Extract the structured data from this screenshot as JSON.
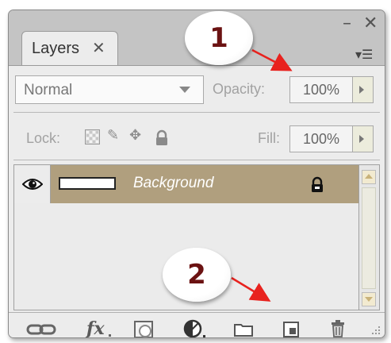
{
  "panel": {
    "minimize_icon": "minimize-icon",
    "close_icon": "close-icon",
    "tab_label": "Layers",
    "tab_close_icon": "close-icon",
    "menu_icon": "panel-menu-icon"
  },
  "blend": {
    "mode": "Normal"
  },
  "opacity": {
    "label": "Opacity:",
    "value": "100%"
  },
  "lock": {
    "label": "Lock:",
    "icons": [
      "lock-transparent-icon",
      "lock-image-icon",
      "lock-position-icon",
      "lock-all-icon"
    ]
  },
  "fill": {
    "label": "Fill:",
    "value": "100%"
  },
  "layers": [
    {
      "name": "Background",
      "visible": true,
      "locked": true
    }
  ],
  "footer": {
    "buttons": [
      "link-layers-icon",
      "fx-icon",
      "layer-mask-icon",
      "adjustment-layer-icon",
      "new-group-icon",
      "new-layer-icon",
      "trash-icon"
    ],
    "fx_label": "fx"
  },
  "annotations": [
    {
      "number": "1"
    },
    {
      "number": "2"
    }
  ],
  "colors": {
    "selected_layer": "#b09f7e",
    "annotation_arrow": "#e8221e",
    "annotation_number": "#6b1212"
  }
}
